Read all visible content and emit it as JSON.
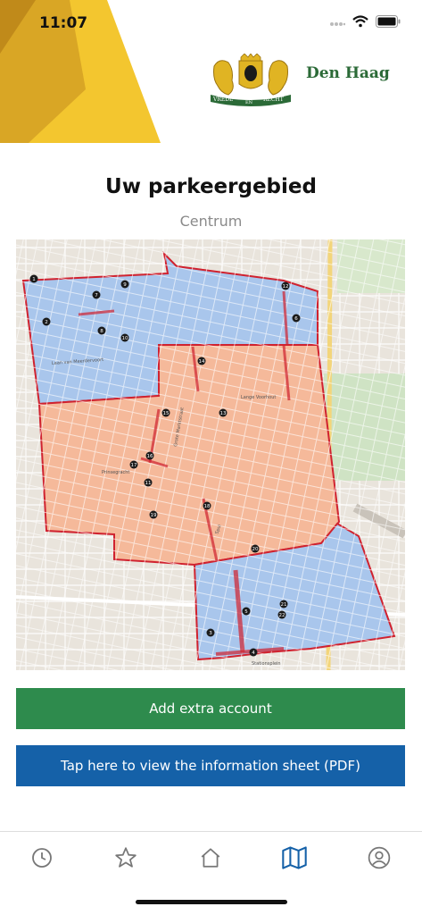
{
  "status_bar": {
    "time": "11:07"
  },
  "brand": {
    "name": "Den Haag",
    "motto_left": "VREDE",
    "motto_mid": "EN",
    "motto_right": "RECHT"
  },
  "page": {
    "title": "Uw parkeergebied",
    "subtitle": "Centrum"
  },
  "buttons": {
    "add_account": "Add extra account",
    "info_sheet": "Tap here to view the information sheet (PDF)"
  },
  "map": {
    "zone_numbers": [
      "1",
      "2",
      "3",
      "4",
      "5",
      "6",
      "7",
      "8",
      "9",
      "10",
      "11",
      "12",
      "13",
      "14",
      "15",
      "16",
      "17",
      "18",
      "19",
      "20",
      "21",
      "22"
    ],
    "street_labels": [
      "Laan van Meerdervoort",
      "Prinsegracht",
      "Grote Marktstraat",
      "Spui",
      "Lange Voorhout",
      "Stationsplein"
    ],
    "zone_colors": {
      "blue": "#a9c6ec",
      "orange": "#f5b99a",
      "border": "#d0222f"
    }
  },
  "tabbar": {
    "items": [
      "history-tab",
      "favorites-tab",
      "home-tab",
      "map-tab",
      "profile-tab"
    ],
    "active": "map-tab",
    "active_color": "#1561a8",
    "inactive_color": "#777777"
  },
  "colors": {
    "header_yellow": "#f3c62f",
    "header_dark_yellow": "#c9961e",
    "brand_green": "#2b6a37",
    "button_green": "#2e8b4d",
    "button_blue": "#1561a8"
  }
}
